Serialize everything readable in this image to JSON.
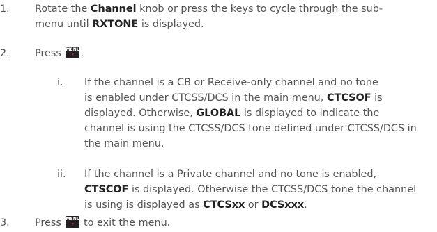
{
  "steps": [
    {
      "number": "1.",
      "parts": [
        "Rotate the ",
        "Channel",
        " knob or press the keys to cycle through the sub-",
        "menu until ",
        "RXTONE",
        " is displayed."
      ]
    },
    {
      "number": "2.",
      "parts": [
        "Press ",
        "."
      ],
      "key": {
        "label": "MENU",
        "sub": "F"
      }
    },
    {
      "number": "i.",
      "parts": [
        "If the channel is a CB or Receive-only channel and no tone",
        "is enabled under CTCSS/DCS in the main menu, ",
        "CTCSOF",
        " is",
        "displayed. Otherwise, ",
        "GLOBAL",
        " is displayed to indicate the",
        "channel is using the CTCSS/DCS tone defined under CTCSS/DCS in",
        "the main menu."
      ]
    },
    {
      "number": "ii.",
      "parts": [
        "If the channel is a Private channel and no tone is enabled,",
        "CTSCOF",
        " is displayed. Otherwise the CTCSS/DCS tone the channel",
        "is using is displayed as ",
        "CTCSxx",
        " or ",
        "DCSxxx",
        "."
      ]
    },
    {
      "number": "3.",
      "parts": [
        "Press ",
        " to exit the menu."
      ],
      "key": {
        "label": "MENU",
        "sub": "F"
      }
    }
  ]
}
